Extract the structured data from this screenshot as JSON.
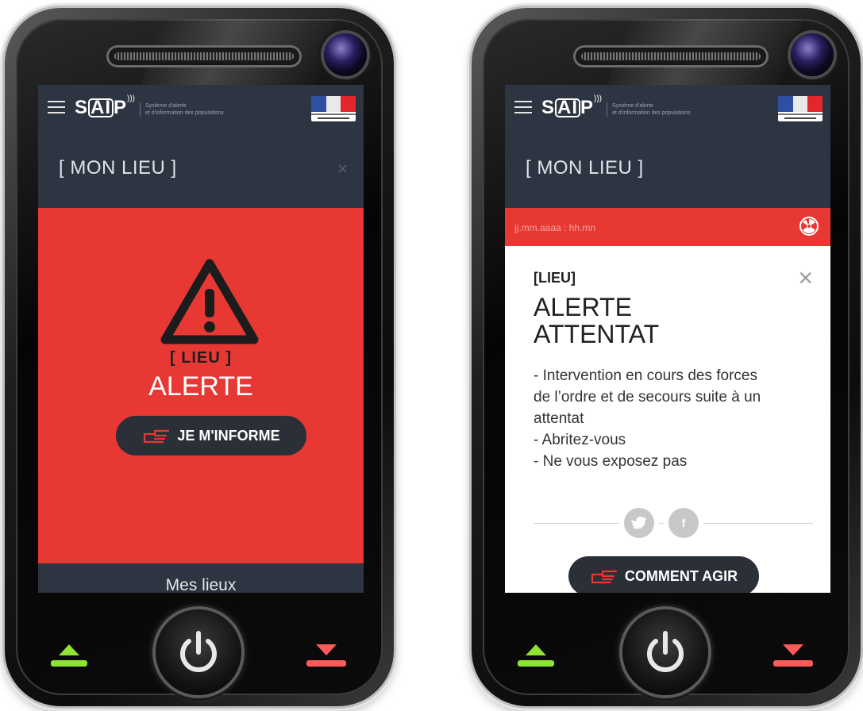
{
  "app": {
    "logo_text": "SAIP",
    "tagline_line1": "Système d'alerte",
    "tagline_line2": "et d'information des populations"
  },
  "left_screen": {
    "place_title": "[ MON LIEU ]",
    "close_symbol": "×",
    "alert_location": "[ LIEU ]",
    "alert_word": "ALERTE",
    "inform_button": "JE M'INFORME",
    "bottom_nav_label": "Mes lieux",
    "alert_color": "#e73834"
  },
  "right_screen": {
    "place_title": "[ MON LIEU ]",
    "datetime": "jj.mm.aaaa : hh.mn",
    "alert_location": "[LIEU]",
    "alert_title_line1": "ALERTE",
    "alert_title_line2": "ATTENTAT",
    "close_symbol": "×",
    "instructions": [
      "- Intervention en cours des forces",
      "de l’ordre et de secours suite à un",
      "attentat",
      "- Abritez-vous",
      "- Ne vous exposez pas"
    ],
    "social": {
      "twitter_icon": "twitter-icon",
      "facebook_label": "f"
    },
    "action_button": "COMMENT AGIR"
  },
  "icons": {
    "menu": "hamburger-icon",
    "warning": "warning-triangle-icon",
    "hand_pointer": "hand-pointer-icon",
    "radiation": "radiation-icon",
    "answer": "answer-call-icon",
    "hang_up": "hang-up-icon",
    "power": "power-icon"
  },
  "colors": {
    "header_bg": "#2d3442",
    "alert_red": "#e73834",
    "button_dark": "#2b2f38",
    "answer_green": "#8fe334",
    "hangup_red": "#ff5a5a"
  }
}
